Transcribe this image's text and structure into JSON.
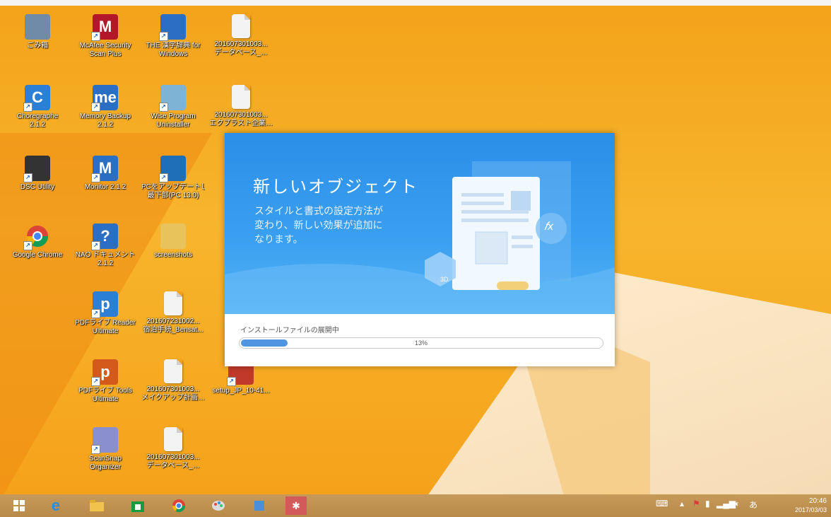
{
  "desktop": {
    "icons": [
      {
        "label": "ごみ箱",
        "icon": "recycle-bin-icon",
        "color": "#6f8ba8"
      },
      {
        "label": "McAfee Security\nScan Plus",
        "icon": "mcafee-icon",
        "color": "#b3182a"
      },
      {
        "label": "THE 漢字辞典 for\nWindows",
        "icon": "dictionary-icon",
        "color": "#2a6fc4"
      },
      {
        "label": "201607301003...\nデータベース_…",
        "icon": "document-icon",
        "color": "#f3f3f3"
      },
      {
        "label": "Choregraphe\n2.1.2",
        "icon": "choregraphe-icon",
        "color": "#2b7fd4"
      },
      {
        "label": "Memory Backup\n2.1.2",
        "icon": "memory-backup-icon",
        "color": "#2a6fc4"
      },
      {
        "label": "Wise Program\nUninstaller",
        "icon": "wise-uninstaller-icon",
        "color": "#7fb3d6"
      },
      {
        "label": "201607301003...\nエクプラスト企業…",
        "icon": "document-icon",
        "color": "#f3f3f3"
      },
      {
        "label": "DSC Utility",
        "icon": "camera-icon",
        "color": "#333333"
      },
      {
        "label": "Monitor 2.1.2",
        "icon": "monitor-m-icon",
        "color": "#2a6fc4"
      },
      {
        "label": "PCをアップデートし\n最下部(PC 13.0)",
        "icon": "pc-update-icon",
        "color": "#1e6fb8"
      },
      {
        "label": "Google Chrome",
        "icon": "chrome-icon",
        "color": "#e0e0e0"
      },
      {
        "label": "NAO ドキュメント\n2.1.2",
        "icon": "help-icon",
        "color": "#2a6fc4"
      },
      {
        "label": "screenshots",
        "icon": "folder-icon",
        "color": "#e8c25a"
      },
      {
        "label": "PDFライブ Reader\nUltimate",
        "icon": "pdf-reader-icon",
        "color": "#2b7fd4"
      },
      {
        "label": "201607231002...\n宿泊手続_Bensat...",
        "icon": "document-icon",
        "color": "#f3f3f3"
      },
      {
        "label": "PDFライブ Tools\nUltimate",
        "icon": "pdf-tools-icon",
        "color": "#d35a1a"
      },
      {
        "label": "201607301003...\nメイクアップ計画…",
        "icon": "document-icon",
        "color": "#f3f3f3"
      },
      {
        "label": "setup_JP_10-41...",
        "icon": "setup-icon",
        "color": "#c0392b"
      },
      {
        "label": "ScanSnap\nOrganizer",
        "icon": "scansnap-icon",
        "color": "#8a8fd0"
      },
      {
        "label": "201607301003...\nデータベース_…",
        "icon": "document-icon",
        "color": "#f3f3f3"
      }
    ]
  },
  "installer": {
    "title": "新しいオブジェクト",
    "description": "スタイルと書式の設定方法が\n変わり、新しい効果が追加に\nなります。",
    "status_label": "インストールファイルの展開中",
    "progress_text": "13%",
    "progress_value": 0.13,
    "accent": "#2b8ee8"
  },
  "taskbar": {
    "buttons": [
      "windows-start-icon",
      "internet-explorer-icon",
      "file-explorer-icon",
      "store-icon",
      "chrome-icon",
      "paint-icon",
      "app-icon",
      "app-red-icon"
    ],
    "time": "20:46",
    "date": "2017/03/03"
  }
}
